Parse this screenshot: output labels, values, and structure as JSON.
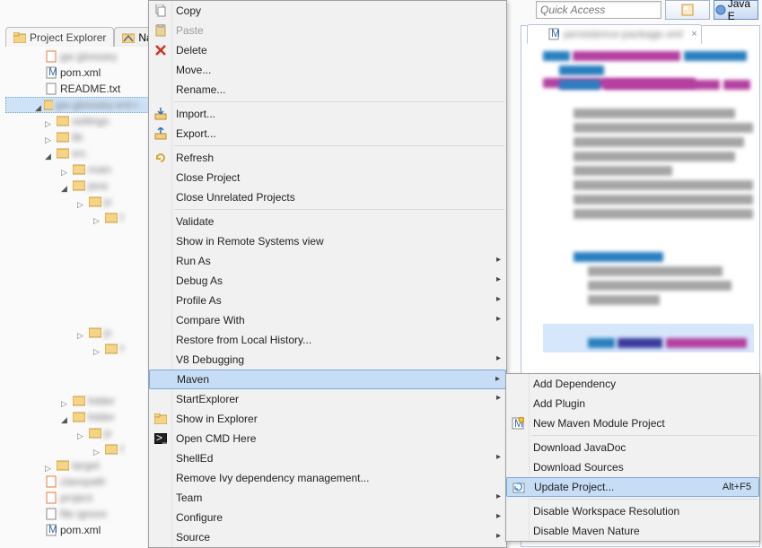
{
  "topbar": {
    "quick_access_placeholder": "Quick Access",
    "perspective_label": "Java E"
  },
  "left_tabs": {
    "tab1": "Project Explorer",
    "tab2": "Na"
  },
  "tree": {
    "pom_xml": "pom.xml",
    "readme": "README.txt",
    "proj_blur": "gw-glossary-ent-l…",
    "pom_xml2": "pom.xml"
  },
  "ctx_menu": {
    "copy": "Copy",
    "paste": "Paste",
    "delete": "Delete",
    "move": "Move...",
    "rename": "Rename...",
    "import": "Import...",
    "export": "Export...",
    "refresh": "Refresh",
    "close_project": "Close Project",
    "close_unrelated": "Close Unrelated Projects",
    "validate": "Validate",
    "show_remote": "Show in Remote Systems view",
    "run_as": "Run As",
    "debug_as": "Debug As",
    "profile_as": "Profile As",
    "compare_with": "Compare With",
    "restore_history": "Restore from Local History...",
    "v8_debugging": "V8 Debugging",
    "maven": "Maven",
    "start_explorer": "StartExplorer",
    "show_in_explorer": "Show in Explorer",
    "open_cmd": "Open CMD Here",
    "shelled": "ShellEd",
    "remove_ivy": "Remove Ivy dependency management...",
    "team": "Team",
    "configure": "Configure",
    "source": "Source"
  },
  "submenu": {
    "add_dependency": "Add Dependency",
    "add_plugin": "Add Plugin",
    "new_maven_module": "New Maven Module Project",
    "download_javadoc": "Download JavaDoc",
    "download_sources": "Download Sources",
    "update_project": "Update Project...",
    "update_project_kb": "Alt+F5",
    "disable_workspace": "Disable Workspace Resolution",
    "disable_maven": "Disable Maven Nature"
  },
  "editor": {
    "tab_title": "persistence-package.xml"
  }
}
